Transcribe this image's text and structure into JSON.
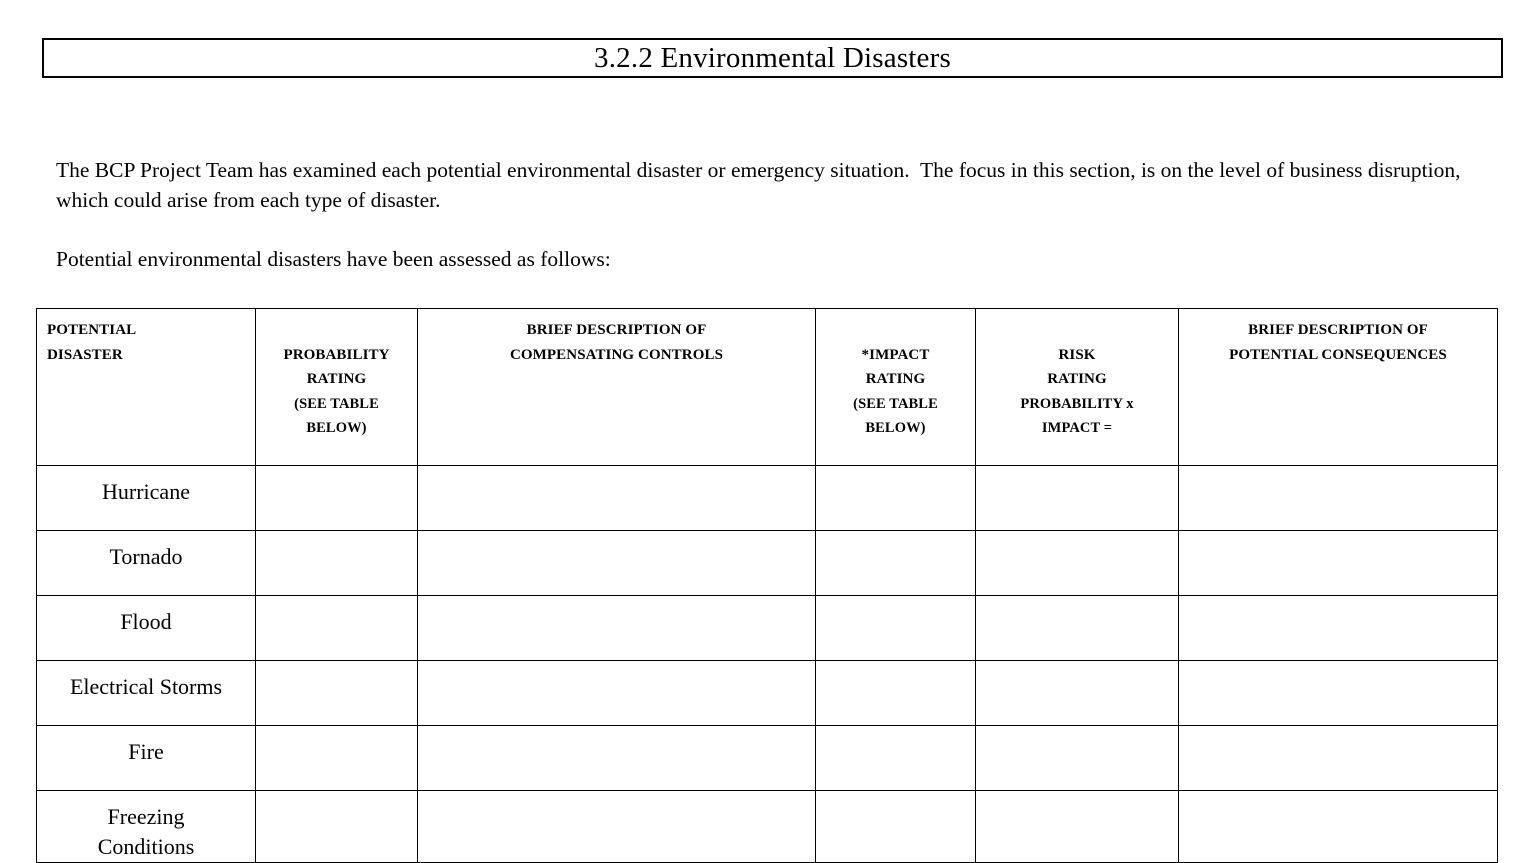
{
  "document": {
    "title": "3.2.2 Environmental Disasters",
    "paragraphs": [
      "The BCP Project Team has examined each potential environmental disaster or emergency situation.  The focus in this section, is on the level of business disruption, which could arise from each type of disaster.",
      "Potential environmental disasters have been assessed as follows:"
    ]
  },
  "table": {
    "headers": {
      "disaster": "POTENTIAL\nDISASTER",
      "probability_main": "PROBABILITY\nRATING",
      "probability_sub": "(SEE TABLE\nBELOW)",
      "controls": "BRIEF  DESCRIPTION OF\nCOMPENSATING CONTROLS",
      "impact_main": "*IMPACT\nRATING",
      "impact_sub": "(SEE TABLE\nBELOW)",
      "risk_main": "RISK\nRATING",
      "risk_sub": "PROBABILITY x\nIMPACT =",
      "consequences": "BRIEF DESCRIPTION OF\nPOTENTIAL CONSEQUENCES"
    },
    "rows": [
      {
        "disaster": "Hurricane",
        "probability": "",
        "controls": "",
        "impact": "",
        "risk": "",
        "consequences": ""
      },
      {
        "disaster": "Tornado",
        "probability": "",
        "controls": "",
        "impact": "",
        "risk": "",
        "consequences": ""
      },
      {
        "disaster": "Flood",
        "probability": "",
        "controls": "",
        "impact": "",
        "risk": "",
        "consequences": ""
      },
      {
        "disaster": "Electrical Storms",
        "probability": "",
        "controls": "",
        "impact": "",
        "risk": "",
        "consequences": ""
      },
      {
        "disaster": "Fire",
        "probability": "",
        "controls": "",
        "impact": "",
        "risk": "",
        "consequences": ""
      },
      {
        "disaster": "Freezing\nConditions",
        "probability": "",
        "controls": "",
        "impact": "",
        "risk": "",
        "consequences": ""
      }
    ]
  },
  "colors": {
    "page_background": "#ffffff",
    "text": "#000000",
    "border": "#000000"
  }
}
